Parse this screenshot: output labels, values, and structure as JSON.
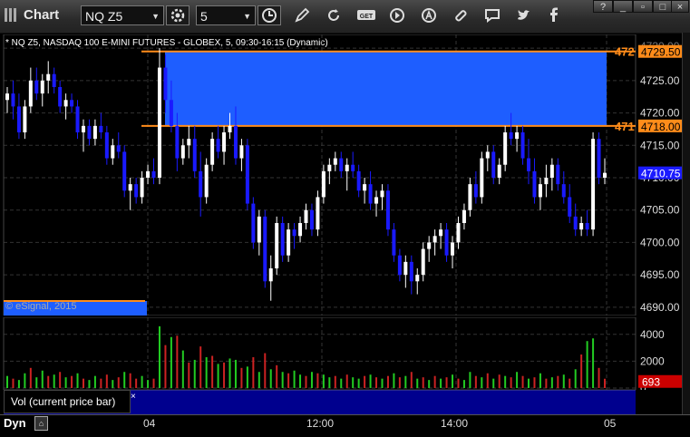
{
  "window": {
    "title": "Chart",
    "symbol": "NQ Z5",
    "interval": "5",
    "subtitle": "* NQ Z5, NASDAQ 100 E-MINI FUTURES - GLOBEX, 5, 09:30-16:15 (Dynamic)",
    "watermark": "© eSignal, 2015"
  },
  "toolbar": {
    "icons": [
      "settings-icon",
      "clock-icon",
      "pencil-icon",
      "refresh-icon",
      "get-icon",
      "play-icon",
      "alert-icon",
      "link-icon",
      "comment-icon",
      "twitter-icon",
      "facebook-icon"
    ],
    "get_label": "GET"
  },
  "price_axis": {
    "ticks": [
      "4725.00",
      "4720.00",
      "4715.00",
      "4710.00",
      "4705.00",
      "4700.00",
      "4695.00",
      "4690.00"
    ],
    "ticks_top_partial": "4730.00",
    "zone_top_label": "4729.50",
    "zone_bottom_label": "4718.00",
    "zone_top_left_label": "472",
    "zone_bottom_left_label": "471",
    "last_price": "4710.75"
  },
  "volume_axis": {
    "ticks": [
      "4000",
      "2000",
      "0"
    ],
    "last_volume": "693"
  },
  "study": {
    "label": "Vol (current price bar)",
    "close": "×"
  },
  "bottom": {
    "mode": "Dyn",
    "time_labels": [
      "04",
      "12:00",
      "14:00",
      "05"
    ]
  },
  "colors": {
    "up": "#ffffff",
    "down": "#1a1aff",
    "zone": "#1e5eff",
    "zone_line": "#ff8c1a",
    "vol_up": "#22cc22",
    "vol_down": "#cc2222",
    "last_vol_bg": "#cc0000",
    "last_price_bg": "#1a1aff"
  },
  "chart_data": {
    "type": "candlestick",
    "ylim": [
      4689,
      4731
    ],
    "zone": {
      "top": 4729.5,
      "bottom": 4718
    },
    "last_price": 4710.75,
    "ohlc": [
      [
        4722,
        4724,
        4720,
        4723
      ],
      [
        4723,
        4725,
        4719,
        4721
      ],
      [
        4721,
        4723,
        4716,
        4717
      ],
      [
        4717,
        4722,
        4716,
        4721
      ],
      [
        4721,
        4727,
        4720,
        4725
      ],
      [
        4725,
        4727,
        4722,
        4723
      ],
      [
        4723,
        4726,
        4721,
        4725
      ],
      [
        4725,
        4728,
        4723,
        4726
      ],
      [
        4726,
        4727,
        4723,
        4724
      ],
      [
        4724,
        4725,
        4720,
        4721
      ],
      [
        4721,
        4723,
        4719,
        4722
      ],
      [
        4722,
        4723,
        4720,
        4721
      ],
      [
        4721,
        4722,
        4716,
        4717
      ],
      [
        4717,
        4719,
        4714,
        4718
      ],
      [
        4718,
        4719,
        4715,
        4716
      ],
      [
        4716,
        4719,
        4715,
        4718
      ],
      [
        4718,
        4720,
        4716,
        4717
      ],
      [
        4717,
        4718,
        4712,
        4713
      ],
      [
        4713,
        4716,
        4712,
        4715
      ],
      [
        4715,
        4717,
        4713,
        4714
      ],
      [
        4714,
        4715,
        4707,
        4708
      ],
      [
        4708,
        4710,
        4705,
        4709
      ],
      [
        4709,
        4710,
        4706,
        4707
      ],
      [
        4707,
        4711,
        4706,
        4710
      ],
      [
        4710,
        4712,
        4709,
        4711
      ],
      [
        4711,
        4713,
        4709,
        4710
      ],
      [
        4710,
        4730,
        4709,
        4727
      ],
      [
        4727,
        4729,
        4720,
        4722
      ],
      [
        4722,
        4725,
        4717,
        4718
      ],
      [
        4718,
        4720,
        4711,
        4713
      ],
      [
        4713,
        4716,
        4712,
        4715
      ],
      [
        4715,
        4718,
        4713,
        4716
      ],
      [
        4716,
        4718,
        4710,
        4711
      ],
      [
        4711,
        4714,
        4704,
        4707
      ],
      [
        4707,
        4713,
        4706,
        4712
      ],
      [
        4712,
        4717,
        4711,
        4716
      ],
      [
        4716,
        4718,
        4713,
        4714
      ],
      [
        4714,
        4718,
        4712,
        4717
      ],
      [
        4717,
        4720,
        4716,
        4718
      ],
      [
        4718,
        4721,
        4712,
        4713
      ],
      [
        4713,
        4716,
        4711,
        4715
      ],
      [
        4715,
        4716,
        4705,
        4706
      ],
      [
        4706,
        4707,
        4699,
        4700
      ],
      [
        4700,
        4705,
        4698,
        4704
      ],
      [
        4704,
        4705,
        4693,
        4694
      ],
      [
        4694,
        4698,
        4691,
        4696
      ],
      [
        4696,
        4704,
        4695,
        4703
      ],
      [
        4703,
        4704,
        4697,
        4698
      ],
      [
        4698,
        4703,
        4697,
        4702
      ],
      [
        4702,
        4703,
        4699,
        4701
      ],
      [
        4701,
        4704,
        4700,
        4703
      ],
      [
        4703,
        4706,
        4702,
        4705
      ],
      [
        4705,
        4706,
        4701,
        4702
      ],
      [
        4702,
        4708,
        4701,
        4707
      ],
      [
        4707,
        4712,
        4706,
        4711
      ],
      [
        4711,
        4713,
        4709,
        4712
      ],
      [
        4712,
        4714,
        4711,
        4713
      ],
      [
        4713,
        4714,
        4710,
        4711
      ],
      [
        4711,
        4713,
        4708,
        4712
      ],
      [
        4712,
        4714,
        4710,
        4711
      ],
      [
        4711,
        4712,
        4707,
        4708
      ],
      [
        4708,
        4710,
        4706,
        4709
      ],
      [
        4709,
        4711,
        4705,
        4706
      ],
      [
        4706,
        4708,
        4704,
        4707
      ],
      [
        4707,
        4709,
        4705,
        4708
      ],
      [
        4708,
        4709,
        4701,
        4702
      ],
      [
        4702,
        4703,
        4697,
        4698
      ],
      [
        4698,
        4699,
        4694,
        4695
      ],
      [
        4695,
        4698,
        4693,
        4697
      ],
      [
        4697,
        4698,
        4692,
        4694
      ],
      [
        4694,
        4696,
        4692,
        4695
      ],
      [
        4695,
        4700,
        4694,
        4699
      ],
      [
        4699,
        4701,
        4697,
        4700
      ],
      [
        4700,
        4702,
        4698,
        4701
      ],
      [
        4701,
        4703,
        4699,
        4702
      ],
      [
        4702,
        4703,
        4697,
        4698
      ],
      [
        4698,
        4701,
        4696,
        4700
      ],
      [
        4700,
        4704,
        4699,
        4703
      ],
      [
        4703,
        4706,
        4702,
        4705
      ],
      [
        4705,
        4710,
        4704,
        4709
      ],
      [
        4709,
        4711,
        4706,
        4707
      ],
      [
        4707,
        4714,
        4706,
        4713
      ],
      [
        4713,
        4715,
        4711,
        4714
      ],
      [
        4714,
        4715,
        4709,
        4710
      ],
      [
        4710,
        4713,
        4709,
        4712
      ],
      [
        4712,
        4718,
        4711,
        4717
      ],
      [
        4717,
        4720,
        4715,
        4716
      ],
      [
        4716,
        4718,
        4714,
        4717
      ],
      [
        4717,
        4718,
        4712,
        4713
      ],
      [
        4713,
        4716,
        4709,
        4711
      ],
      [
        4711,
        4713,
        4706,
        4707
      ],
      [
        4707,
        4710,
        4705,
        4709
      ],
      [
        4709,
        4712,
        4707,
        4710
      ],
      [
        4710,
        4713,
        4708,
        4712
      ],
      [
        4712,
        4713,
        4708,
        4709
      ],
      [
        4709,
        4711,
        4706,
        4707
      ],
      [
        4707,
        4709,
        4703,
        4704
      ],
      [
        4704,
        4706,
        4701,
        4702
      ],
      [
        4702,
        4704,
        4701,
        4703
      ],
      [
        4703,
        4705,
        4701,
        4702
      ],
      [
        4702,
        4717,
        4701,
        4716
      ],
      [
        4716,
        4717,
        4709,
        4710
      ],
      [
        4710,
        4713,
        4709,
        4710.75
      ]
    ],
    "volume": [
      [
        900,
        1
      ],
      [
        700,
        0
      ],
      [
        600,
        1
      ],
      [
        1100,
        1
      ],
      [
        1500,
        0
      ],
      [
        800,
        1
      ],
      [
        1300,
        1
      ],
      [
        900,
        0
      ],
      [
        1000,
        1
      ],
      [
        1200,
        0
      ],
      [
        800,
        1
      ],
      [
        900,
        0
      ],
      [
        1100,
        1
      ],
      [
        700,
        0
      ],
      [
        600,
        1
      ],
      [
        900,
        1
      ],
      [
        700,
        0
      ],
      [
        1000,
        0
      ],
      [
        600,
        1
      ],
      [
        800,
        0
      ],
      [
        1200,
        1
      ],
      [
        1100,
        0
      ],
      [
        700,
        0
      ],
      [
        900,
        1
      ],
      [
        600,
        1
      ],
      [
        700,
        0
      ],
      [
        4600,
        1
      ],
      [
        3200,
        0
      ],
      [
        3800,
        1
      ],
      [
        3900,
        0
      ],
      [
        2800,
        1
      ],
      [
        1900,
        0
      ],
      [
        2100,
        1
      ],
      [
        3100,
        0
      ],
      [
        2300,
        1
      ],
      [
        2400,
        0
      ],
      [
        1800,
        1
      ],
      [
        1900,
        0
      ],
      [
        2200,
        1
      ],
      [
        2100,
        1
      ],
      [
        1500,
        0
      ],
      [
        1600,
        1
      ],
      [
        2300,
        0
      ],
      [
        1200,
        1
      ],
      [
        2600,
        0
      ],
      [
        1400,
        1
      ],
      [
        1700,
        0
      ],
      [
        1200,
        1
      ],
      [
        1100,
        0
      ],
      [
        1300,
        1
      ],
      [
        1000,
        1
      ],
      [
        900,
        0
      ],
      [
        1200,
        1
      ],
      [
        1100,
        0
      ],
      [
        1000,
        1
      ],
      [
        800,
        1
      ],
      [
        900,
        0
      ],
      [
        700,
        1
      ],
      [
        1000,
        0
      ],
      [
        800,
        1
      ],
      [
        700,
        1
      ],
      [
        900,
        0
      ],
      [
        1000,
        1
      ],
      [
        800,
        0
      ],
      [
        700,
        1
      ],
      [
        900,
        0
      ],
      [
        1100,
        1
      ],
      [
        800,
        0
      ],
      [
        900,
        1
      ],
      [
        1200,
        0
      ],
      [
        700,
        1
      ],
      [
        800,
        0
      ],
      [
        600,
        1
      ],
      [
        900,
        0
      ],
      [
        700,
        1
      ],
      [
        800,
        0
      ],
      [
        1000,
        1
      ],
      [
        700,
        0
      ],
      [
        600,
        1
      ],
      [
        1200,
        1
      ],
      [
        900,
        0
      ],
      [
        800,
        1
      ],
      [
        1100,
        0
      ],
      [
        700,
        1
      ],
      [
        1000,
        0
      ],
      [
        900,
        1
      ],
      [
        800,
        0
      ],
      [
        1200,
        1
      ],
      [
        900,
        0
      ],
      [
        700,
        1
      ],
      [
        800,
        0
      ],
      [
        1100,
        1
      ],
      [
        700,
        0
      ],
      [
        800,
        1
      ],
      [
        900,
        0
      ],
      [
        1000,
        1
      ],
      [
        700,
        0
      ],
      [
        1400,
        1
      ],
      [
        2500,
        0
      ],
      [
        3500,
        1
      ],
      [
        3700,
        1
      ],
      [
        1500,
        0
      ],
      [
        693,
        0
      ]
    ]
  }
}
